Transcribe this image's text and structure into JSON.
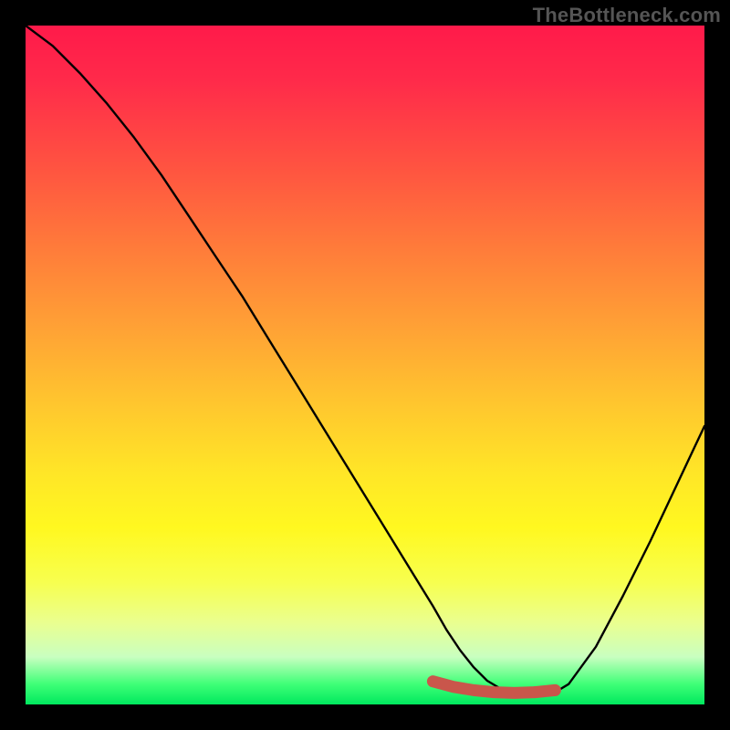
{
  "branding": {
    "watermark": "TheBottleneck.com"
  },
  "colors": {
    "gradient_top": "#ff1a4a",
    "gradient_bottom": "#00e85e",
    "curve": "#000000",
    "marker": "#c9564b",
    "frame": "#000000"
  },
  "chart_data": {
    "type": "line",
    "title": "",
    "xlabel": "",
    "ylabel": "",
    "xlim": [
      0,
      100
    ],
    "ylim": [
      0,
      100
    ],
    "background": "rainbow-vertical-gradient",
    "series": [
      {
        "name": "bottleneck-curve",
        "x": [
          0,
          4,
          8,
          12,
          16,
          20,
          24,
          28,
          32,
          36,
          40,
          44,
          48,
          52,
          56,
          60,
          62,
          64,
          66,
          68,
          70,
          72,
          74,
          76,
          78,
          80,
          84,
          88,
          92,
          96,
          100
        ],
        "y": [
          100,
          97,
          93,
          88.5,
          83.5,
          78,
          72,
          66,
          60,
          53.5,
          47,
          40.5,
          34,
          27.5,
          21,
          14.5,
          11,
          8,
          5.5,
          3.5,
          2.3,
          1.6,
          1.3,
          1.4,
          1.8,
          3.0,
          8.5,
          16,
          24,
          32.5,
          41
        ]
      }
    ],
    "marker_range": {
      "name": "optimal-range",
      "x": [
        60,
        63,
        66,
        69,
        72,
        75,
        78
      ],
      "y": [
        3.4,
        2.6,
        2.1,
        1.8,
        1.7,
        1.8,
        2.1
      ]
    }
  }
}
